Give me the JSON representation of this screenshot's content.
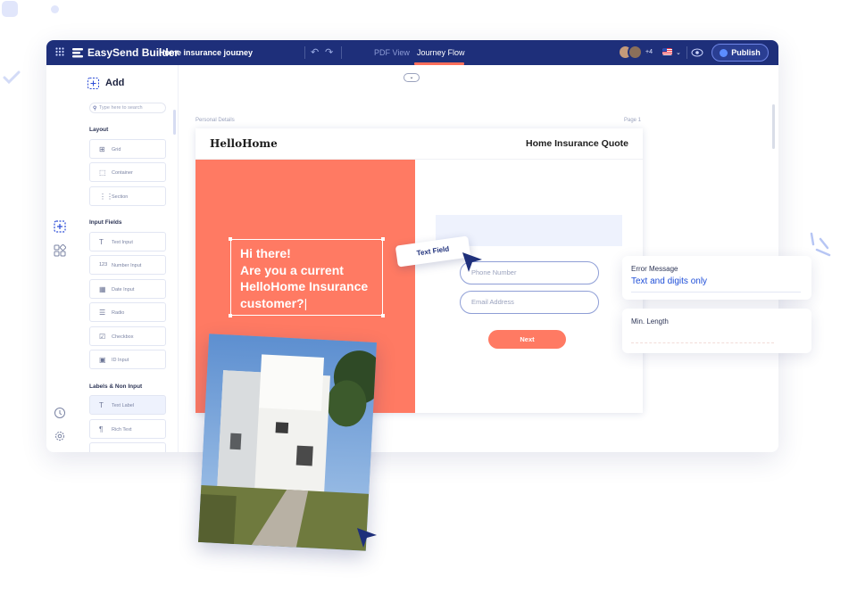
{
  "colors": {
    "navy": "#1e2f7a",
    "coral": "#ff7a63",
    "accent_blue": "#1f4fd8",
    "light_blue": "#eef2fd"
  },
  "topbar": {
    "brand": "EasySend Builder",
    "journey": "Home insurance journey",
    "tabs": [
      {
        "label": "PDF View",
        "active": false
      },
      {
        "label": "Journey Flow",
        "active": true
      }
    ],
    "collaborators_extra": "+4",
    "publish_label": "Publish"
  },
  "add_panel": {
    "title": "Add",
    "search_placeholder": "Type here to search",
    "sections": [
      {
        "label": "Layout",
        "items": [
          {
            "label": "Grid",
            "icon": "grid-icon"
          },
          {
            "label": "Container",
            "icon": "container-icon"
          },
          {
            "label": "Section",
            "icon": "section-icon"
          }
        ]
      },
      {
        "label": "Input Fields",
        "items": [
          {
            "label": "Text Input",
            "icon": "text-icon"
          },
          {
            "label": "Number Input",
            "icon": "number-icon"
          },
          {
            "label": "Date Input",
            "icon": "calendar-icon"
          },
          {
            "label": "Radio",
            "icon": "radio-icon"
          },
          {
            "label": "Checkbox",
            "icon": "checkbox-icon"
          },
          {
            "label": "ID Input",
            "icon": "id-icon"
          }
        ]
      },
      {
        "label": "Labels & Non Input",
        "items": [
          {
            "label": "Text Label",
            "icon": "text-icon"
          },
          {
            "label": "Rich Text",
            "icon": "paragraph-icon"
          }
        ]
      }
    ]
  },
  "canvas": {
    "breadcrumb": "Personal Details",
    "page_number": "Page 1",
    "form": {
      "logo": "HelloHome",
      "title": "Home Insurance Quote",
      "greeting_lines": [
        "Hi there!",
        "Are you a current",
        "HelloHome Insurance",
        "customer?"
      ],
      "phone_placeholder": "Phone Number",
      "email_placeholder": "Email Address",
      "next_label": "Next"
    }
  },
  "overlays": {
    "text_field_tag": "Text Field",
    "error_message": {
      "label": "Error Message",
      "value": "Text and digits only"
    },
    "min_length": {
      "label": "Min. Length",
      "value": ""
    }
  }
}
